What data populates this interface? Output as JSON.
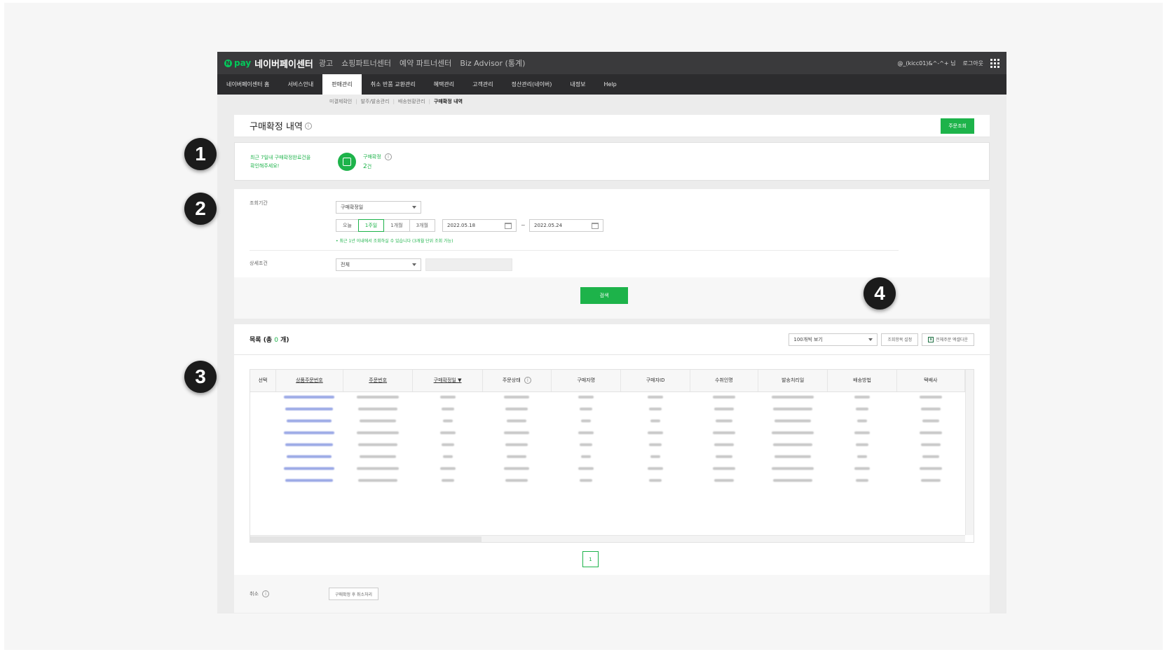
{
  "topbar": {
    "pay_logo": "pay",
    "pay_logo_mark": "N",
    "title": "네이버페이센터",
    "links": [
      "광고",
      "쇼핑파트너센터",
      "예약 파트너센터",
      "Biz Advisor (통계)"
    ],
    "user": "@_(kicc01)&^-^+ 님",
    "logout": "로그아웃",
    "apps_icon": "grid-icon"
  },
  "nav": {
    "items": [
      "네이버페이센터 홈",
      "서비스안내",
      "판매관리",
      "취소 반품 교환관리",
      "혜택관리",
      "고객관리",
      "정산관리(네이버)",
      "내정보",
      "Help"
    ],
    "active": "판매관리"
  },
  "subnav": {
    "items": [
      "미결제확인",
      "발주/발송관리",
      "배송현황관리"
    ],
    "current": "구매확정 내역"
  },
  "page": {
    "title": "구매확정 내역",
    "order_search_button": "주문조회"
  },
  "summary": {
    "message_line1": "최근 7일내 구매확정완료건을",
    "message_line2": "확인해주세요!",
    "stat_label": "구매확정",
    "stat_count": "2",
    "stat_unit": "건"
  },
  "search": {
    "period_label": "조회기간",
    "date_type": "구매확정일",
    "range_buttons": [
      "오늘",
      "1주일",
      "1개월",
      "3개월"
    ],
    "active_range": "1주일",
    "start_date": "2022.05.18",
    "end_date": "2022.05.24",
    "date_separator": "~",
    "note": "• 최근 1년 이내에서 조회하실 수 있습니다 (3개월 단위 조회 가능)",
    "detail_label": "상세조건",
    "detail_value": "전체",
    "search_button": "검색"
  },
  "list": {
    "title": "목록 (총 ",
    "count": "0",
    "title_suffix": " 개)",
    "page_size": "100개씩 보기",
    "columns_button": "조회항목 설정",
    "excel_button": "전체주문 엑셀다운",
    "columns": [
      "선택",
      "상품주문번호",
      "주문번호",
      "구매확정일 ▼",
      "주문상태",
      "구매자명",
      "구매자ID",
      "수취인명",
      "발송처리일",
      "배송방법",
      "택배사"
    ],
    "row_count": 8,
    "page": "1"
  },
  "cancel": {
    "label": "취소",
    "button": "구매확정 후 취소처리"
  },
  "badges": [
    "1",
    "2",
    "3",
    "4"
  ],
  "colors": {
    "accent": "#1db34a",
    "header_bg": "#3a3a3c",
    "nav_bg": "#2c2c2e",
    "badge_bg": "#1b1b1b"
  }
}
